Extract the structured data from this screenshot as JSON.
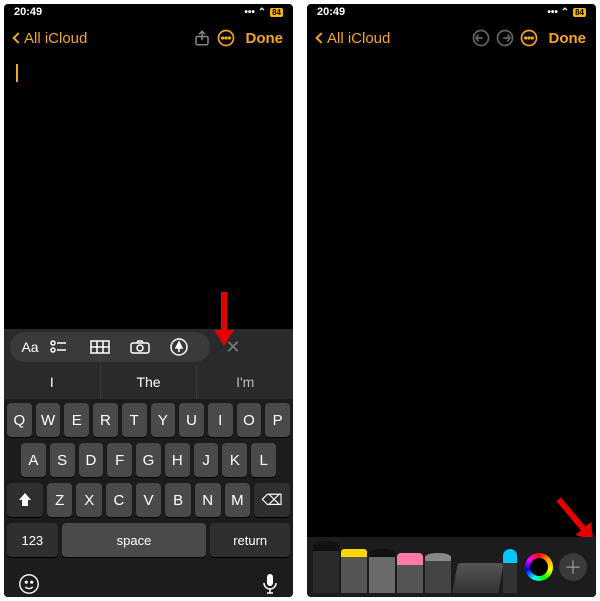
{
  "status": {
    "time": "20:49",
    "network": "••• ⌃",
    "battery": "84"
  },
  "nav": {
    "back": "All iCloud",
    "done": "Done"
  },
  "suggestions": [
    "I",
    "The",
    "I'm"
  ],
  "kb": {
    "row1": [
      "Q",
      "W",
      "E",
      "R",
      "T",
      "Y",
      "U",
      "I",
      "O",
      "P"
    ],
    "row2": [
      "A",
      "S",
      "D",
      "F",
      "G",
      "H",
      "J",
      "K",
      "L"
    ],
    "row3": [
      "Z",
      "X",
      "C",
      "V",
      "B",
      "N",
      "M"
    ],
    "shift": "⇧",
    "del": "⌫",
    "num": "123",
    "space": "space",
    "ret": "return",
    "emoji": "☺",
    "mic": "🎤"
  },
  "toolbar": {
    "aa": "Aa",
    "close": "✕"
  },
  "tools": {
    "plus": "＋"
  }
}
